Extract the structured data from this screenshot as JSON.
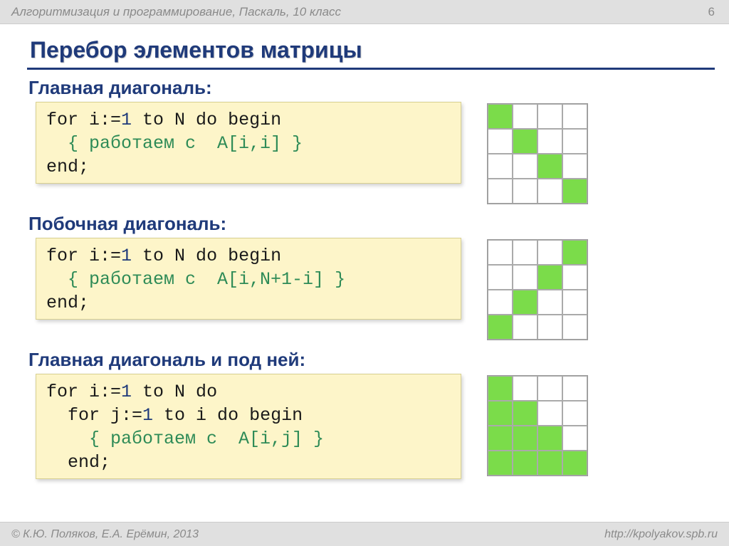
{
  "header": {
    "subject": "Алгоритмизация и программирование, Паскаль, 10 класс",
    "page": "6"
  },
  "title": "Перебор элементов матрицы",
  "sections": [
    {
      "label": "Главная диагональ:",
      "code": {
        "l1a": "for i:=",
        "l1num": "1",
        "l1b": " to N do begin",
        "l2": "  { работаем с  A[i,i] }",
        "l3": "end;"
      },
      "matrix": [
        [
          1,
          0,
          0,
          0
        ],
        [
          0,
          1,
          0,
          0
        ],
        [
          0,
          0,
          1,
          0
        ],
        [
          0,
          0,
          0,
          1
        ]
      ]
    },
    {
      "label": "Побочная диагональ:",
      "code": {
        "l1a": "for i:=",
        "l1num": "1",
        "l1b": " to N do begin",
        "l2": "  { работаем с  A[i,N+1-i] }",
        "l3": "end;"
      },
      "matrix": [
        [
          0,
          0,
          0,
          1
        ],
        [
          0,
          0,
          1,
          0
        ],
        [
          0,
          1,
          0,
          0
        ],
        [
          1,
          0,
          0,
          0
        ]
      ]
    },
    {
      "label": "Главная диагональ и под ней:",
      "code": {
        "l1a": "for i:=",
        "l1num": "1",
        "l1b": " to N do",
        "l2a": "  for j:=",
        "l2num": "1",
        "l2b": " to i do begin",
        "l3": "    { работаем с  A[i,j] }",
        "l4": "  end;"
      },
      "matrix": [
        [
          1,
          0,
          0,
          0
        ],
        [
          1,
          1,
          0,
          0
        ],
        [
          1,
          1,
          1,
          0
        ],
        [
          1,
          1,
          1,
          1
        ]
      ]
    }
  ],
  "footer": {
    "left": "© К.Ю. Поляков, Е.А. Ерёмин, 2013",
    "right": "http://kpolyakov.spb.ru"
  }
}
